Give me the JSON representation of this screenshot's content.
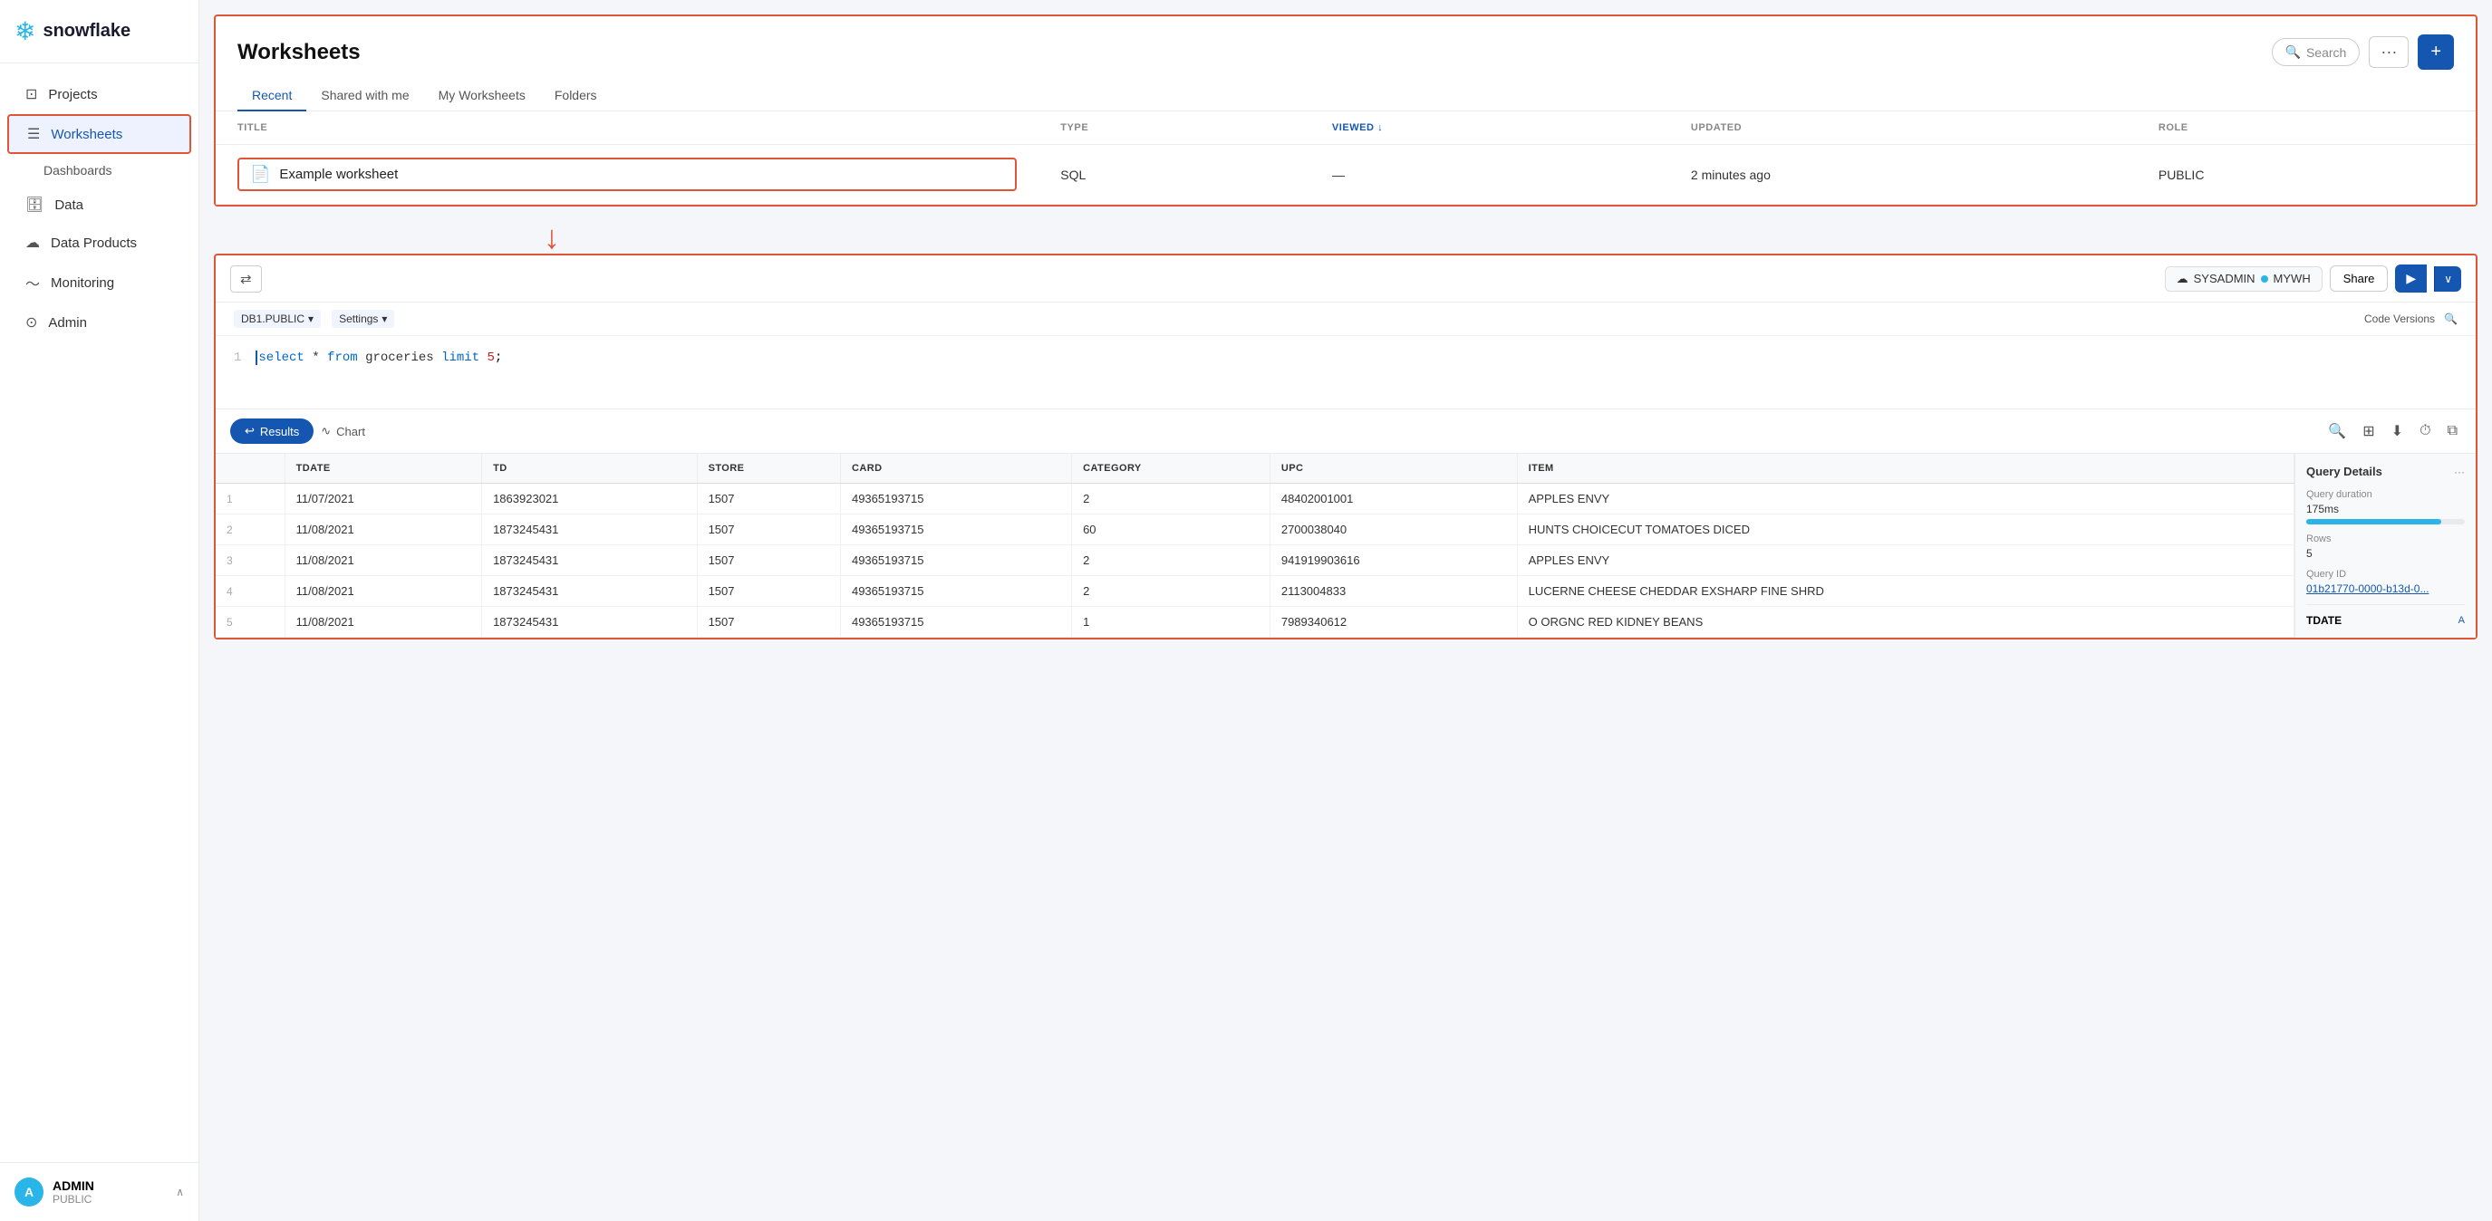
{
  "sidebar": {
    "brand": "snowflake",
    "nav": [
      {
        "id": "projects",
        "label": "Projects",
        "icon": "⊞"
      },
      {
        "id": "worksheets",
        "label": "Worksheets",
        "icon": "☰",
        "active": true
      },
      {
        "id": "dashboards",
        "label": "Dashboards",
        "icon": ""
      },
      {
        "id": "data",
        "label": "Data",
        "icon": "🗄"
      },
      {
        "id": "data-products",
        "label": "Data Products",
        "icon": "☁"
      },
      {
        "id": "monitoring",
        "label": "Monitoring",
        "icon": "📈"
      },
      {
        "id": "admin",
        "label": "Admin",
        "icon": "🔒"
      }
    ],
    "footer": {
      "avatar_initial": "A",
      "username": "ADMIN",
      "role": "PUBLIC",
      "chevron": "∧"
    }
  },
  "worksheets": {
    "title": "Worksheets",
    "search_label": "Search",
    "dots_label": "···",
    "plus_label": "+",
    "tabs": [
      {
        "id": "recent",
        "label": "Recent",
        "active": true
      },
      {
        "id": "shared",
        "label": "Shared with me"
      },
      {
        "id": "my",
        "label": "My Worksheets"
      },
      {
        "id": "folders",
        "label": "Folders"
      }
    ],
    "columns": [
      {
        "id": "title",
        "label": "TITLE",
        "sorted": false
      },
      {
        "id": "type",
        "label": "TYPE",
        "sorted": false
      },
      {
        "id": "viewed",
        "label": "VIEWED",
        "sorted": true
      },
      {
        "id": "updated",
        "label": "UPDATED",
        "sorted": false
      },
      {
        "id": "role",
        "label": "ROLE",
        "sorted": false
      }
    ],
    "rows": [
      {
        "title": "Example worksheet",
        "type": "SQL",
        "viewed": "—",
        "updated": "2 minutes ago",
        "role": "PUBLIC"
      }
    ]
  },
  "editor": {
    "filter_icon": "⇄",
    "db_label": "DB1.PUBLIC",
    "settings_label": "Settings",
    "code_versions_label": "Code Versions",
    "sysadmin_label": "SYSADMIN",
    "mywh_label": "MYWH",
    "share_label": "Share",
    "run_icon": "▶",
    "chevron_down": "∨",
    "line_number": "1",
    "code": "select * from groceries limit 5;",
    "code_keyword_select": "select",
    "code_star": "*",
    "code_from": "from",
    "code_table": "groceries",
    "code_limit": "limit",
    "code_num": "5",
    "code_semi": ";"
  },
  "results": {
    "results_label": "Results",
    "results_icon": "↩",
    "chart_label": "Chart",
    "chart_icon": "∿",
    "search_icon": "🔍",
    "columns_icon": "⊞",
    "download_icon": "⬇",
    "clock_icon": "⏱",
    "split_icon": "⧉",
    "columns": [
      "TDATE",
      "TD",
      "STORE",
      "CARD",
      "CATEGORY",
      "UPC",
      "ITEM"
    ],
    "rows": [
      {
        "num": "1",
        "tdate": "11/07/2021",
        "td": "1863923021",
        "store": "1507",
        "card": "49365193715",
        "category": "2",
        "upc": "48402001001",
        "item": "APPLES ENVY"
      },
      {
        "num": "2",
        "tdate": "11/08/2021",
        "td": "1873245431",
        "store": "1507",
        "card": "49365193715",
        "category": "60",
        "upc": "2700038040",
        "item": "HUNTS CHOICECUT TOMATOES DICED"
      },
      {
        "num": "3",
        "tdate": "11/08/2021",
        "td": "1873245431",
        "store": "1507",
        "card": "49365193715",
        "category": "2",
        "upc": "941919903616",
        "item": "APPLES ENVY"
      },
      {
        "num": "4",
        "tdate": "11/08/2021",
        "td": "1873245431",
        "store": "1507",
        "card": "49365193715",
        "category": "2",
        "upc": "2113004833",
        "item": "LUCERNE CHEESE CHEDDAR EXSHARP FINE SHRD"
      },
      {
        "num": "5",
        "tdate": "11/08/2021",
        "td": "1873245431",
        "store": "1507",
        "card": "49365193715",
        "category": "1",
        "upc": "7989340612",
        "item": "O ORGNC RED KIDNEY BEANS"
      }
    ],
    "query_details": {
      "title": "Query Details",
      "dots": "···",
      "duration_label": "Query duration",
      "duration_value": "175ms",
      "rows_label": "Rows",
      "rows_value": "5",
      "query_id_label": "Query ID",
      "query_id_value": "01b21770-0000-b13d-0...",
      "tdate_label": "TDATE",
      "tdate_value": "A"
    }
  }
}
